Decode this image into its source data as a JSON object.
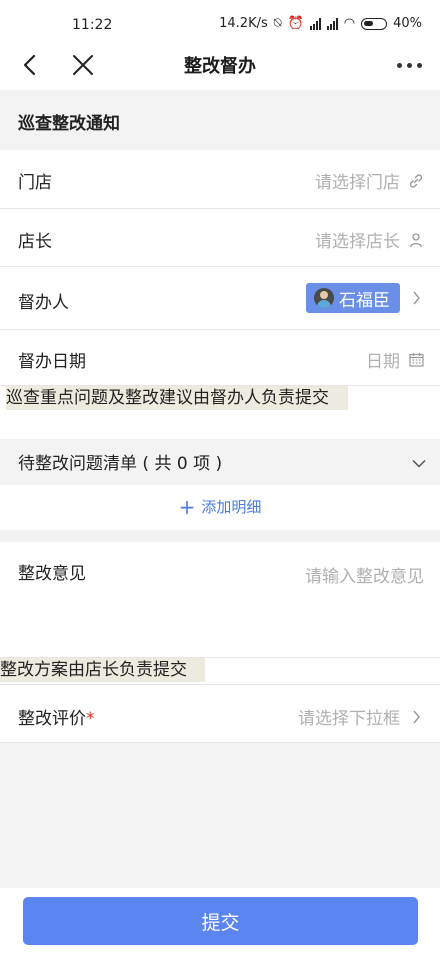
{
  "status_bar": {
    "time": "11:22",
    "net_speed": "14.2K/s",
    "battery": "40%"
  },
  "nav": {
    "title": "整改督办"
  },
  "section": {
    "title": "巡查整改通知"
  },
  "fields": {
    "store": {
      "label": "门店",
      "placeholder": "请选择门店",
      "icon": "link-icon"
    },
    "manager": {
      "label": "店长",
      "placeholder": "请选择店长",
      "icon": "person-icon"
    },
    "supervisor": {
      "label": "督办人",
      "value": "石福臣",
      "icon": "chevron-right-icon"
    },
    "supervise_date": {
      "label": "督办日期",
      "placeholder": "日期",
      "icon": "calendar-icon"
    }
  },
  "note_supervisor": "巡查重点问题及整改建议由督办人负责提交",
  "issue_list": {
    "label": "待整改问题清单 ( 共 0 项 )",
    "count": 0,
    "add_label": "添加明细"
  },
  "opinion": {
    "label": "整改意见",
    "placeholder": "请输入整改意见"
  },
  "note_manager": "整改方案由店长负责提交",
  "evaluation": {
    "label": "整改评价",
    "required_mark": "*",
    "placeholder": "请选择下拉框"
  },
  "footer": {
    "submit_label": "提交"
  },
  "colors": {
    "accent": "#5b86ef",
    "tag": "#6a8fe6",
    "link": "#4a7bd8",
    "required": "#e0302b",
    "note_bg": "#edebe0"
  }
}
